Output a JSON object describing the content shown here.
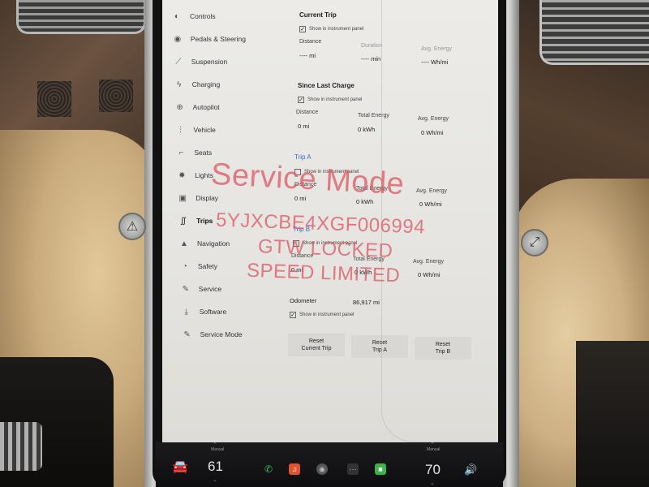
{
  "nav": {
    "items": [
      {
        "label": "Controls",
        "icon": "toggle-icon",
        "glyph": "◐"
      },
      {
        "label": "Pedals & Steering",
        "icon": "car-icon",
        "glyph": "◉"
      },
      {
        "label": "Suspension",
        "icon": "suspension-icon",
        "glyph": "⟋"
      },
      {
        "label": "Charging",
        "icon": "bolt-icon",
        "glyph": "ϟ"
      },
      {
        "label": "Autopilot",
        "icon": "steering-wheel-icon",
        "glyph": "⊕"
      },
      {
        "label": "Vehicle",
        "icon": "sliders-icon",
        "glyph": "⫶"
      },
      {
        "label": "Seats",
        "icon": "seat-icon",
        "glyph": "⌐"
      },
      {
        "label": "Lights",
        "icon": "sun-icon",
        "glyph": "✹"
      },
      {
        "label": "Display",
        "icon": "display-icon",
        "glyph": "▣"
      },
      {
        "label": "Trips",
        "icon": "trips-icon",
        "glyph": "∬"
      },
      {
        "label": "Navigation",
        "icon": "navigation-arrow-icon",
        "glyph": "▲"
      },
      {
        "label": "Safety",
        "icon": "safety-icon",
        "glyph": "◔"
      },
      {
        "label": "Service",
        "icon": "wrench-icon",
        "glyph": "✎"
      },
      {
        "label": "Software",
        "icon": "download-icon",
        "glyph": "⤓"
      },
      {
        "label": "Service Mode",
        "icon": "wrench-icon",
        "glyph": "✎"
      }
    ],
    "active": "Trips"
  },
  "current_trip": {
    "title": "Current Trip",
    "show_label": "Show in instrument panel",
    "checked": true,
    "distance_label": "Distance",
    "distance_value": "---- mi",
    "duration_label": "Duration",
    "duration_value": "---- min",
    "energy_label": "Avg. Energy",
    "energy_value": "---- Wh/mi"
  },
  "since_last_charge": {
    "title": "Since Last Charge",
    "show_label": "Show in instrument panel",
    "checked": true,
    "distance_label": "Distance",
    "distance_value": "0 mi",
    "total_energy_label": "Total Energy",
    "total_energy_value": "0 kWh",
    "avg_energy_label": "Avg. Energy",
    "avg_energy_value": "0 Wh/mi"
  },
  "trip_a": {
    "title": "Trip A",
    "show_label": "Show in instrument panel",
    "checked": false,
    "distance_label": "Distance",
    "distance_value": "0 mi",
    "total_energy_label": "Total Energy",
    "total_energy_value": "0 kWh",
    "avg_energy_label": "Avg. Energy",
    "avg_energy_value": "0 Wh/mi"
  },
  "trip_b": {
    "title": "Trip B",
    "show_label": "Show in instrument panel",
    "checked": false,
    "distance_label": "Distance",
    "distance_value": "0 mi",
    "total_energy_label": "Total Energy",
    "total_energy_value": "0 kWh",
    "avg_energy_label": "Avg. Energy",
    "avg_energy_value": "0 Wh/mi"
  },
  "odometer": {
    "label": "Odometer",
    "value": "86,917 mi",
    "show_label": "Show in instrument panel",
    "checked": true
  },
  "buttons": {
    "reset_current": "Reset\nCurrent Trip",
    "reset_a": "Reset\nTrip A",
    "reset_b": "Reset\nTrip B"
  },
  "overlay": {
    "line1": "Service Mode",
    "line2": "5YJXCBE4XGF006994",
    "line3": "GTW LOCKED",
    "line4": "SPEED LIMITED",
    "color": "#de5a64"
  },
  "bottom_bar": {
    "left_temp_label": "Manual",
    "left_temp": "61",
    "right_temp_label": "Manual",
    "right_temp": "70"
  },
  "colors": {
    "screen_bg": "#ecebe7",
    "accent_blue": "#3a6bd0",
    "phone_green": "#2fbf5a",
    "media_orange": "#e0522e"
  }
}
